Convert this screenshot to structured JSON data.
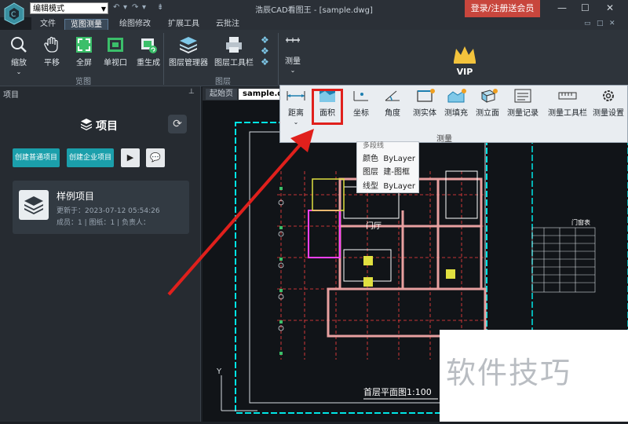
{
  "titlebar": {
    "mode_value": "编辑模式",
    "window_title": "浩辰CAD看图王 - [sample.dwg]",
    "login_label": "登录/注册送会员",
    "min_icon": "minimize-icon",
    "max_icon": "maximize-icon",
    "close_icon": "close-icon"
  },
  "menu": {
    "tabs": [
      {
        "label": "文件"
      },
      {
        "label": "览图测量",
        "active": true
      },
      {
        "label": "绘图修改"
      },
      {
        "label": "扩展工具"
      },
      {
        "label": "云批注"
      }
    ]
  },
  "ribbon": {
    "view_group": {
      "label": "览图",
      "buttons": [
        {
          "label": "缩放",
          "icon": "zoom-icon"
        },
        {
          "label": "平移",
          "icon": "pan-hand-icon"
        },
        {
          "label": "全屏",
          "icon": "fullscreen-icon"
        },
        {
          "label": "单视口",
          "icon": "single-viewport-icon"
        },
        {
          "label": "重生成",
          "icon": "regenerate-icon"
        }
      ]
    },
    "layer_group": {
      "label": "图层",
      "buttons": [
        {
          "label": "图层管理器",
          "icon": "layers-icon"
        },
        {
          "label": "图层工具栏",
          "icon": "printer-icon"
        }
      ]
    },
    "measure_button": {
      "label": "测量",
      "icon": "ruler-icon"
    },
    "vip_label": "VIP"
  },
  "measure_toolbar": {
    "group_label": "测量",
    "buttons": [
      {
        "label": "距离",
        "icon": "distance-icon"
      },
      {
        "label": "面积",
        "icon": "area-icon",
        "highlighted": true
      },
      {
        "label": "坐标",
        "icon": "coordinate-icon"
      },
      {
        "label": "角度",
        "icon": "angle-icon"
      },
      {
        "label": "测实体",
        "icon": "measure-entity-icon"
      },
      {
        "label": "测填充",
        "icon": "measure-hatch-icon"
      },
      {
        "label": "测立面",
        "icon": "measure-elevation-icon"
      },
      {
        "label": "测量记录",
        "icon": "measure-record-icon"
      },
      {
        "label": "测量工具栏",
        "icon": "measure-toolbar-icon"
      },
      {
        "label": "测量设置",
        "icon": "gear-icon"
      }
    ]
  },
  "tooltip": {
    "partial_label": "多段线",
    "rows": [
      {
        "key": "颜色",
        "value": "ByLayer"
      },
      {
        "key": "图层",
        "value": "建-图框"
      },
      {
        "key": "线型",
        "value": "ByLayer"
      }
    ]
  },
  "panel": {
    "header": "项目",
    "title": "项目",
    "create_normal": "创建普通项目",
    "create_enterprise": "创建企业项目",
    "project": {
      "name": "样例项目",
      "updated": "更新于：2023-07-12  05:54:26",
      "meta": "成员：1  |  图纸：1  |  负责人："
    }
  },
  "doc_tabs": [
    {
      "label": "起始页"
    },
    {
      "label": "sample.dwg",
      "active": true
    }
  ],
  "drawing": {
    "plan_title": "首层平面图1:100",
    "door_table_title": "门窗表",
    "room_label": "门厅"
  },
  "watermark": "软件技巧",
  "colors": {
    "accent_teal": "#1b9fab",
    "login_red": "#c8463d",
    "highlight_red": "#e0201c",
    "cad_cyan": "#00e5e5",
    "cad_red": "#ff4040"
  }
}
